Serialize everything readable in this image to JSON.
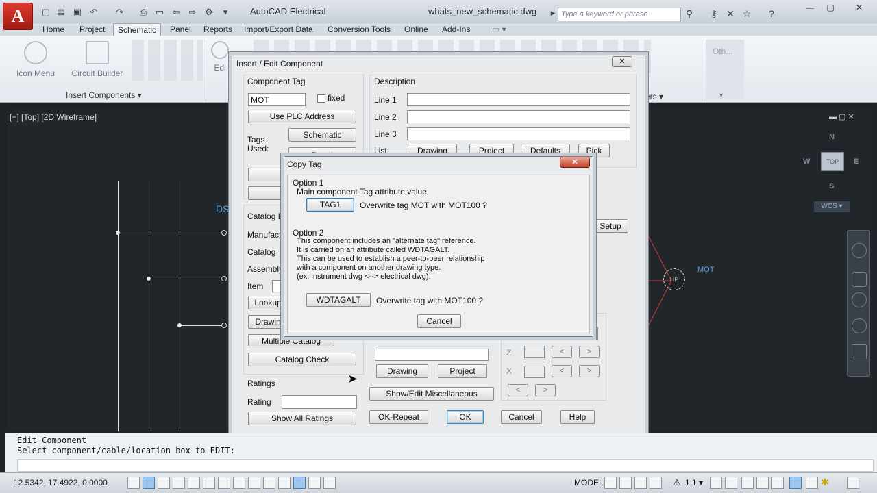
{
  "titlebar": {
    "app_logo": "A",
    "app_title": "AutoCAD Electrical",
    "doc_title": "whats_new_schematic.dwg",
    "search_placeholder": "Type a keyword or phrase"
  },
  "ribbon": {
    "tabs": [
      "Home",
      "Project",
      "Schematic",
      "Panel",
      "Reports",
      "Import/Export Data",
      "Conversion Tools",
      "Online",
      "Add-Ins"
    ],
    "active_tab": "Schematic",
    "icon_menu": "Icon Menu",
    "circuit_builder": "Circuit Builder",
    "insert_components": "Insert Components",
    "edit_partial": "Edi",
    "ers_partial": "ers",
    "other_partial": "Oth..."
  },
  "viewport": {
    "label": "[−] [Top] [2D Wireframe]",
    "ds_text": "DS",
    "mot_text": "MOT",
    "viewcube": {
      "n": "N",
      "s": "S",
      "e": "E",
      "w": "W",
      "top": "TOP",
      "wcs": "WCS"
    }
  },
  "command": {
    "line1": "Edit Component",
    "line2": "Select component/cable/location box to EDIT:"
  },
  "status": {
    "coords": "12.5342, 17.4922, 0.0000",
    "model": "MODEL",
    "scale": "1:1"
  },
  "edit_dialog": {
    "title": "Insert / Edit Component",
    "component_tag_label": "Component Tag",
    "tag_value": "MOT",
    "fixed_label": "fixed",
    "use_plc_address": "Use PLC Address",
    "tags_used_label": "Tags\nUsed:",
    "schematic_btn": "Schematic",
    "panel_btn": "Panel",
    "catalog_data_label": "Catalog Da",
    "manufacturer_label": "Manufactu",
    "catalog_label": "Catalog",
    "assembly_label": "Assembly",
    "item_label": "Item",
    "lookup_btn": "Lookup",
    "drawing_partial_btn": "Drawin",
    "multiple_catalog_btn": "Multiple Catalog",
    "catalog_check_btn": "Catalog Check",
    "ratings_label": "Ratings",
    "rating_label": "Rating",
    "show_all_ratings_btn": "Show All Ratings",
    "description_label": "Description",
    "line1_label": "Line 1",
    "line2_label": "Line 2",
    "line3_label": "Line 3",
    "list_label": "List:",
    "list_drawing_btn": "Drawing",
    "list_project_btn": "Project",
    "list_defaults_btn": "Defaults",
    "list_pick_btn": "Pick",
    "setup_btn": "Setup",
    "lower_drawing_btn": "Drawing",
    "lower_project_btn": "Project",
    "show_edit_misc_btn": "Show/Edit Miscellaneous",
    "ok_repeat_btn": "OK-Repeat",
    "ok_btn": "OK",
    "cancel_btn": "Cancel",
    "help_btn": "Help",
    "z_label": "Z",
    "x_label": "X"
  },
  "copy_tag_dialog": {
    "title": "Copy Tag",
    "option1_heading": "Option 1",
    "option1_desc": "Main component Tag attribute value",
    "tag1_btn": "TAG1",
    "tag1_text": "Overwrite tag MOT with MOT100 ?",
    "option2_heading": "Option 2",
    "option2_lines": [
      "This component includes an \"alternate tag\" reference.",
      "It is carried on an attribute called WDTAGALT.",
      "This can be used to establish a peer-to-peer relationship",
      "with a component on another drawing type.",
      "(ex: instrument dwg <--> electrical dwg)."
    ],
    "wdtagalt_btn": "WDTAGALT",
    "wdtagalt_text": "Overwrite tag  with MOT100 ?",
    "cancel_btn": "Cancel"
  }
}
